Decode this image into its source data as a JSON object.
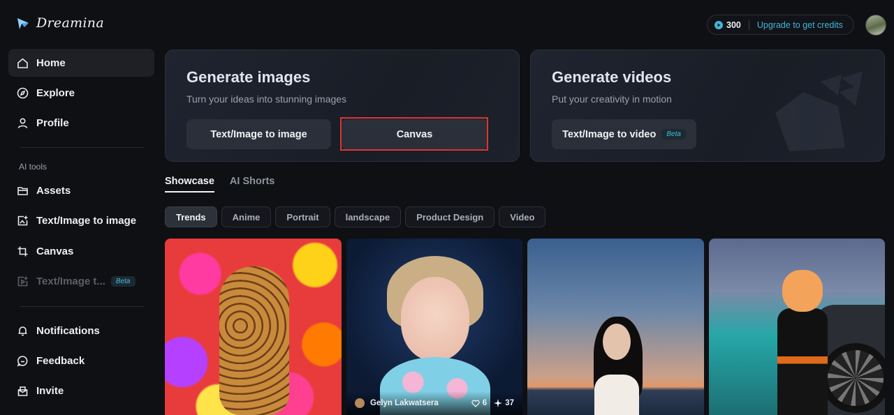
{
  "app": {
    "name": "Dreamina"
  },
  "sidebar": {
    "items": [
      {
        "label": "Home",
        "icon": "home-icon"
      },
      {
        "label": "Explore",
        "icon": "compass-icon"
      },
      {
        "label": "Profile",
        "icon": "user-icon"
      }
    ],
    "ai_tools_label": "AI tools",
    "tools": [
      {
        "label": "Assets",
        "icon": "folder-icon"
      },
      {
        "label": "Text/Image to image",
        "icon": "image-plus-icon"
      },
      {
        "label": "Canvas",
        "icon": "crop-icon"
      },
      {
        "label": "Text/Image t...",
        "icon": "video-plus-icon",
        "badge": "Beta"
      }
    ],
    "bottom": [
      {
        "label": "Notifications",
        "icon": "bell-icon"
      },
      {
        "label": "Feedback",
        "icon": "chat-icon"
      },
      {
        "label": "Invite",
        "icon": "gift-icon"
      }
    ]
  },
  "topbar": {
    "credits": "300",
    "upgrade_label": "Upgrade to get credits"
  },
  "cards": {
    "images": {
      "title": "Generate images",
      "subtitle": "Turn your ideas into stunning images",
      "btn1": "Text/Image to image",
      "btn2": "Canvas"
    },
    "videos": {
      "title": "Generate videos",
      "subtitle": "Put your creativity in motion",
      "btn1": "Text/Image to video",
      "badge": "Beta"
    }
  },
  "tabs": [
    "Showcase",
    "AI Shorts"
  ],
  "chips": [
    "Trends",
    "Anime",
    "Portrait",
    "landscape",
    "Product Design",
    "Video"
  ],
  "gallery": {
    "tile2": {
      "author": "Gelyn Lakwatsera",
      "likes": "6",
      "boosts": "37"
    }
  },
  "colors": {
    "accent": "#3fb8d8",
    "highlight": "#e0342f"
  }
}
